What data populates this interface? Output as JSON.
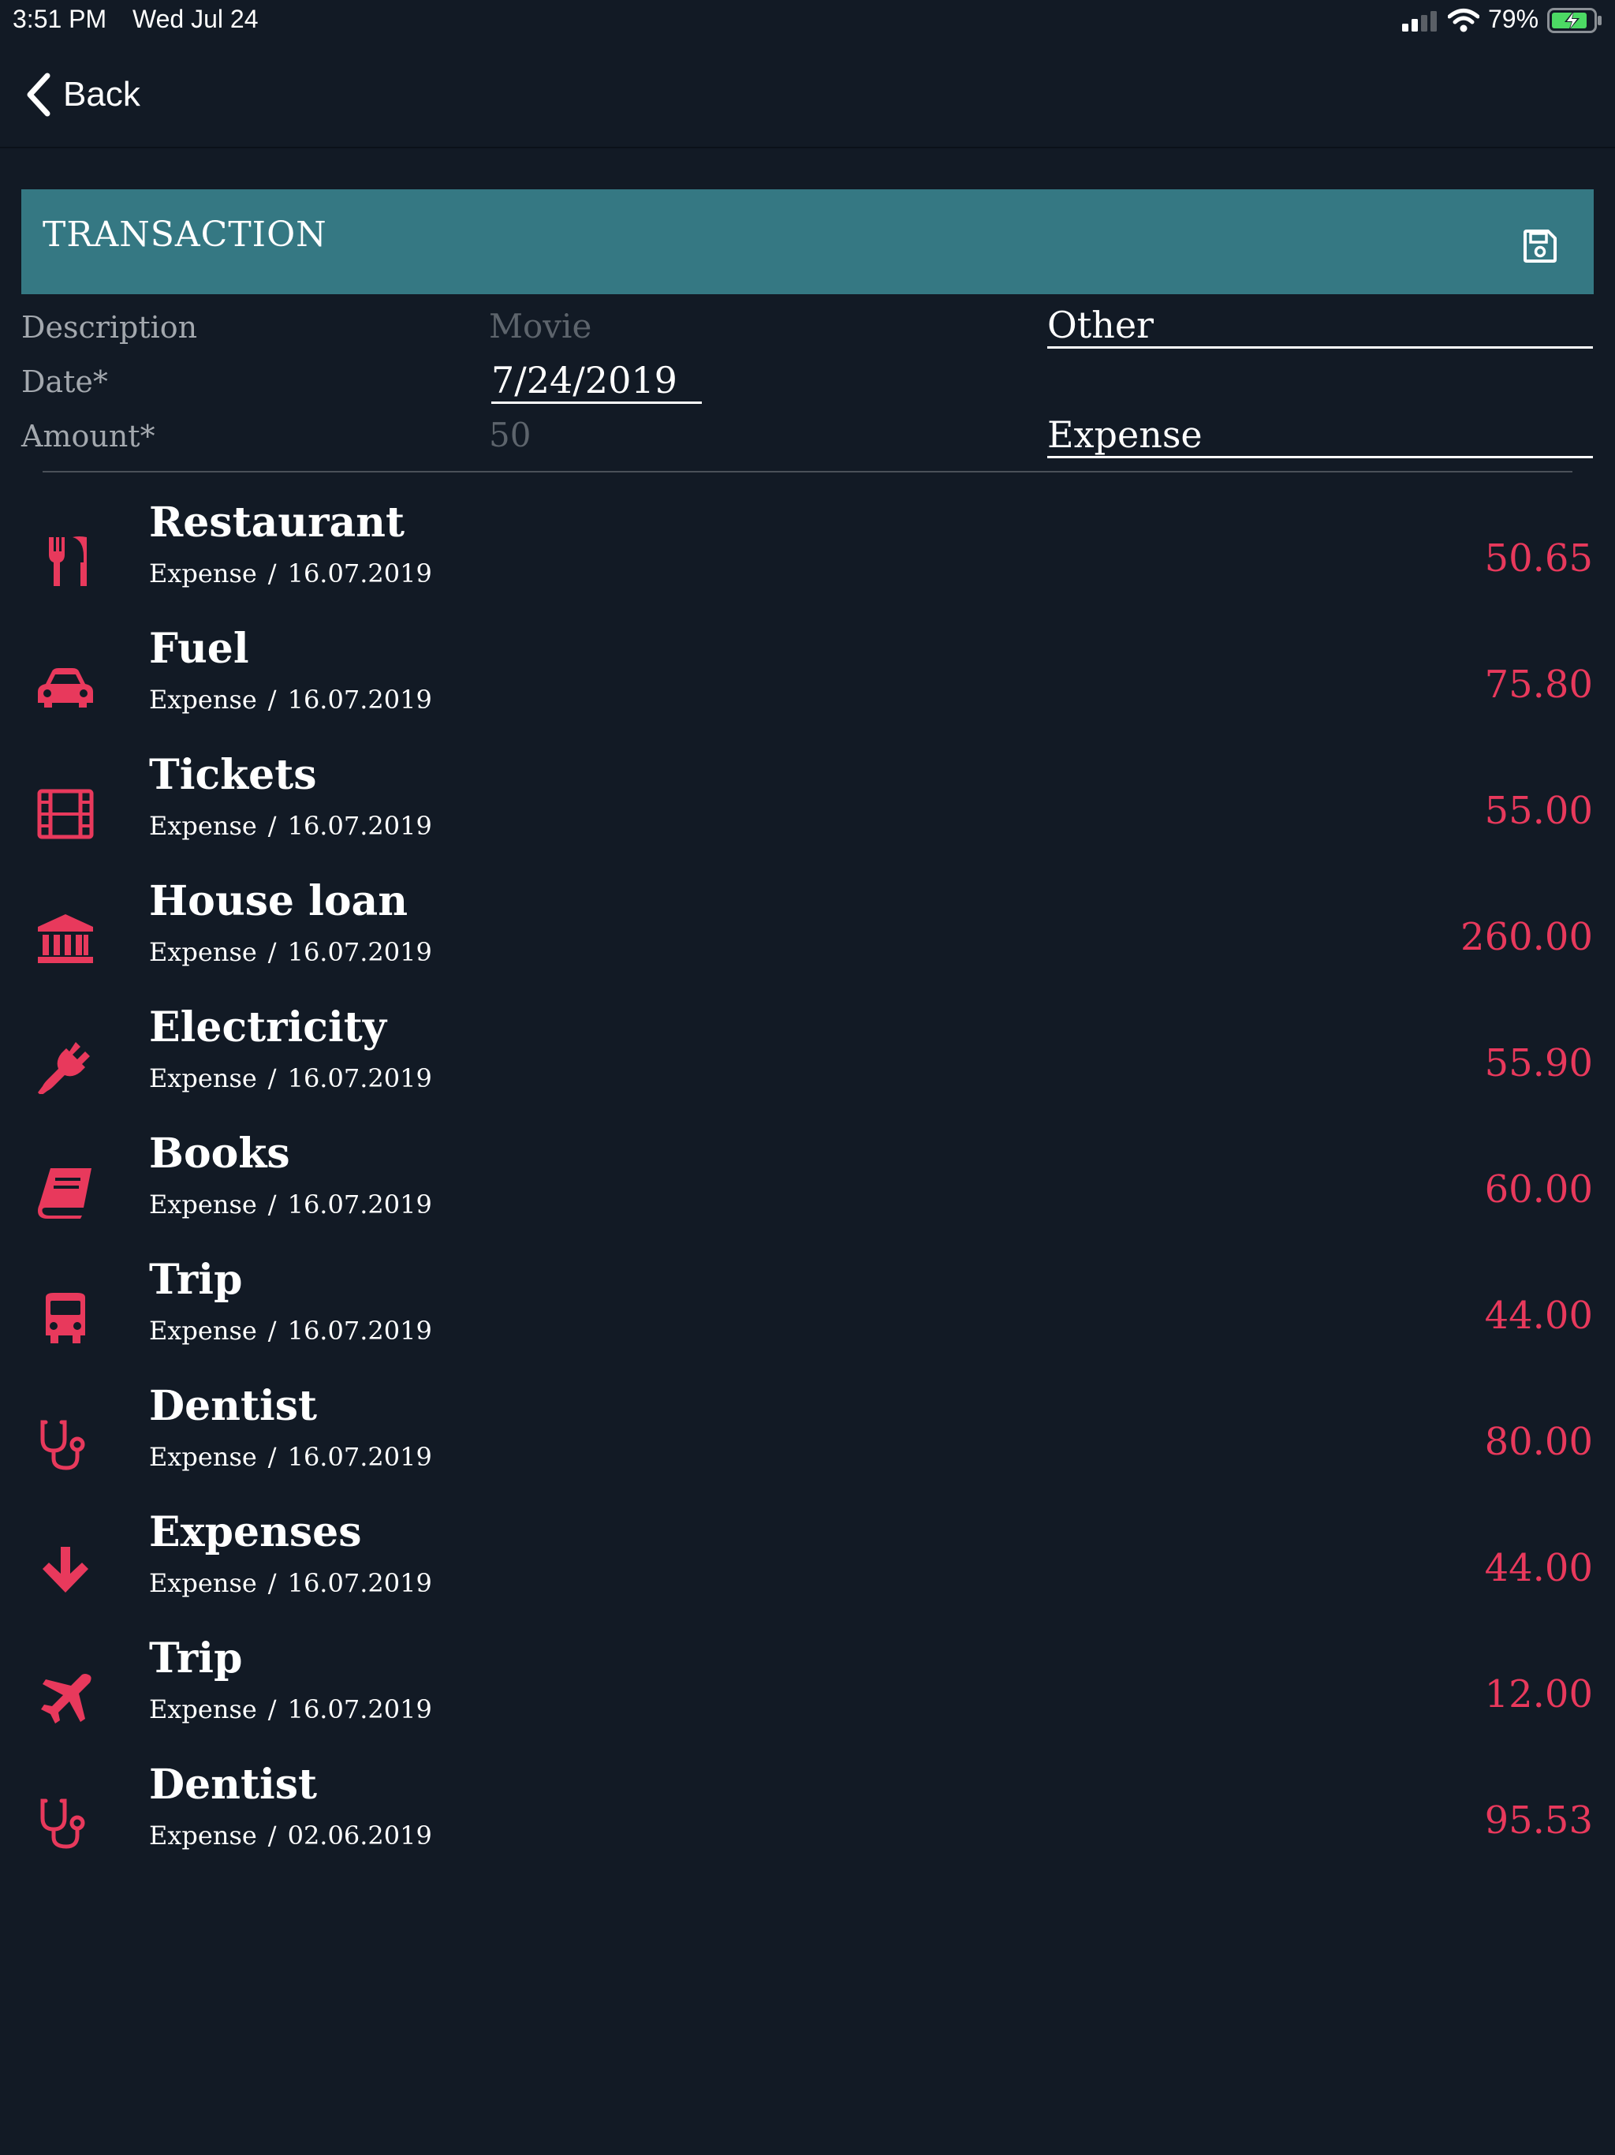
{
  "status_bar": {
    "time": "3:51 PM",
    "date": "Wed Jul 24",
    "battery": "79%"
  },
  "nav": {
    "back_label": "Back"
  },
  "header": {
    "title": "TRANSACTION"
  },
  "form": {
    "description_label": "Description",
    "description_placeholder": "Movie",
    "category_value": "Other",
    "date_label": "Date*",
    "date_value": "7/24/2019",
    "amount_label": "Amount*",
    "amount_placeholder": "50",
    "type_value": "Expense"
  },
  "accent_color": "#e8395c",
  "header_color": "#357883",
  "transactions": [
    {
      "title": "Restaurant",
      "type": "Expense",
      "date": "16.07.2019",
      "amount": "50.65",
      "icon": "utensils-icon"
    },
    {
      "title": "Fuel",
      "type": "Expense",
      "date": "16.07.2019",
      "amount": "75.80",
      "icon": "car-icon"
    },
    {
      "title": "Tickets",
      "type": "Expense",
      "date": "16.07.2019",
      "amount": "55.00",
      "icon": "film-icon"
    },
    {
      "title": "House loan",
      "type": "Expense",
      "date": "16.07.2019",
      "amount": "260.00",
      "icon": "bank-icon"
    },
    {
      "title": "Electricity",
      "type": "Expense",
      "date": "16.07.2019",
      "amount": "55.90",
      "icon": "plug-icon"
    },
    {
      "title": "Books",
      "type": "Expense",
      "date": "16.07.2019",
      "amount": "60.00",
      "icon": "book-icon"
    },
    {
      "title": "Trip",
      "type": "Expense",
      "date": "16.07.2019",
      "amount": "44.00",
      "icon": "bus-icon"
    },
    {
      "title": "Dentist",
      "type": "Expense",
      "date": "16.07.2019",
      "amount": "80.00",
      "icon": "stethoscope-icon"
    },
    {
      "title": "Expenses",
      "type": "Expense",
      "date": "16.07.2019",
      "amount": "44.00",
      "icon": "arrow-down-icon"
    },
    {
      "title": "Trip",
      "type": "Expense",
      "date": "16.07.2019",
      "amount": "12.00",
      "icon": "plane-icon"
    },
    {
      "title": "Dentist",
      "type": "Expense",
      "date": "02.06.2019",
      "amount": "95.53",
      "icon": "stethoscope-icon"
    }
  ]
}
